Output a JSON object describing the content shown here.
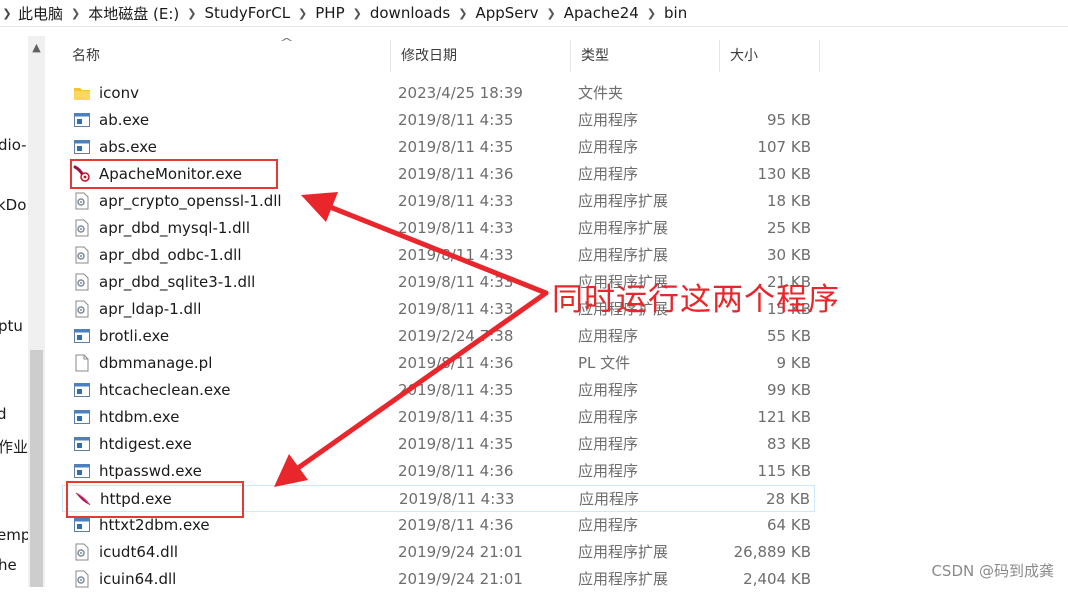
{
  "breadcrumb": {
    "items": [
      "此电脑",
      "本地磁盘 (E:)",
      "StudyForCL",
      "PHP",
      "downloads",
      "AppServ",
      "Apache24",
      "bin"
    ]
  },
  "left_pane": {
    "fragments": [
      "dio-",
      "kDo",
      "ptu",
      "d",
      "作业",
      "emp",
      "he"
    ]
  },
  "columns": {
    "name": "名称",
    "date": "修改日期",
    "type": "类型",
    "size": "大小"
  },
  "files": [
    {
      "name": "iconv",
      "date": "2023/4/25 18:39",
      "type": "文件夹",
      "size": "",
      "icon": "folder-icon"
    },
    {
      "name": "ab.exe",
      "date": "2019/8/11 4:35",
      "type": "应用程序",
      "size": "95 KB",
      "icon": "exe-icon"
    },
    {
      "name": "abs.exe",
      "date": "2019/8/11 4:35",
      "type": "应用程序",
      "size": "107 KB",
      "icon": "exe-icon"
    },
    {
      "name": "ApacheMonitor.exe",
      "date": "2019/8/11 4:36",
      "type": "应用程序",
      "size": "130 KB",
      "icon": "apache-monitor-icon"
    },
    {
      "name": "apr_crypto_openssl-1.dll",
      "date": "2019/8/11 4:33",
      "type": "应用程序扩展",
      "size": "18 KB",
      "icon": "dll-icon"
    },
    {
      "name": "apr_dbd_mysql-1.dll",
      "date": "2019/8/11 4:33",
      "type": "应用程序扩展",
      "size": "25 KB",
      "icon": "dll-icon"
    },
    {
      "name": "apr_dbd_odbc-1.dll",
      "date": "2019/8/11 4:33",
      "type": "应用程序扩展",
      "size": "30 KB",
      "icon": "dll-icon"
    },
    {
      "name": "apr_dbd_sqlite3-1.dll",
      "date": "2019/8/11 4:33",
      "type": "应用程序扩展",
      "size": "21 KB",
      "icon": "dll-icon"
    },
    {
      "name": "apr_ldap-1.dll",
      "date": "2019/8/11 4:33",
      "type": "应用程序扩展",
      "size": "15 KB",
      "icon": "dll-icon"
    },
    {
      "name": "brotli.exe",
      "date": "2019/2/24 7:38",
      "type": "应用程序",
      "size": "55 KB",
      "icon": "exe-icon"
    },
    {
      "name": "dbmmanage.pl",
      "date": "2019/8/11 4:36",
      "type": "PL 文件",
      "size": "9 KB",
      "icon": "file-icon"
    },
    {
      "name": "htcacheclean.exe",
      "date": "2019/8/11 4:35",
      "type": "应用程序",
      "size": "99 KB",
      "icon": "exe-icon"
    },
    {
      "name": "htdbm.exe",
      "date": "2019/8/11 4:35",
      "type": "应用程序",
      "size": "121 KB",
      "icon": "exe-icon"
    },
    {
      "name": "htdigest.exe",
      "date": "2019/8/11 4:35",
      "type": "应用程序",
      "size": "83 KB",
      "icon": "exe-icon"
    },
    {
      "name": "htpasswd.exe",
      "date": "2019/8/11 4:36",
      "type": "应用程序",
      "size": "115 KB",
      "icon": "exe-icon"
    },
    {
      "name": "httpd.exe",
      "date": "2019/8/11 4:33",
      "type": "应用程序",
      "size": "28 KB",
      "icon": "apache-feather-icon",
      "selected": true
    },
    {
      "name": "httxt2dbm.exe",
      "date": "2019/8/11 4:36",
      "type": "应用程序",
      "size": "64 KB",
      "icon": "exe-icon"
    },
    {
      "name": "icudt64.dll",
      "date": "2019/9/24 21:01",
      "type": "应用程序扩展",
      "size": "26,889 KB",
      "icon": "dll-icon"
    },
    {
      "name": "icuin64.dll",
      "date": "2019/9/24 21:01",
      "type": "应用程序扩展",
      "size": "2,404 KB",
      "icon": "dll-icon"
    }
  ],
  "annotation": {
    "text": "同时运行这两个程序",
    "color": "#e8262b"
  },
  "watermark": "CSDN @码到成龚",
  "colors": {
    "highlight": "#e53935",
    "arrow": "#e8262b",
    "selection_border": "#cde8ff"
  }
}
